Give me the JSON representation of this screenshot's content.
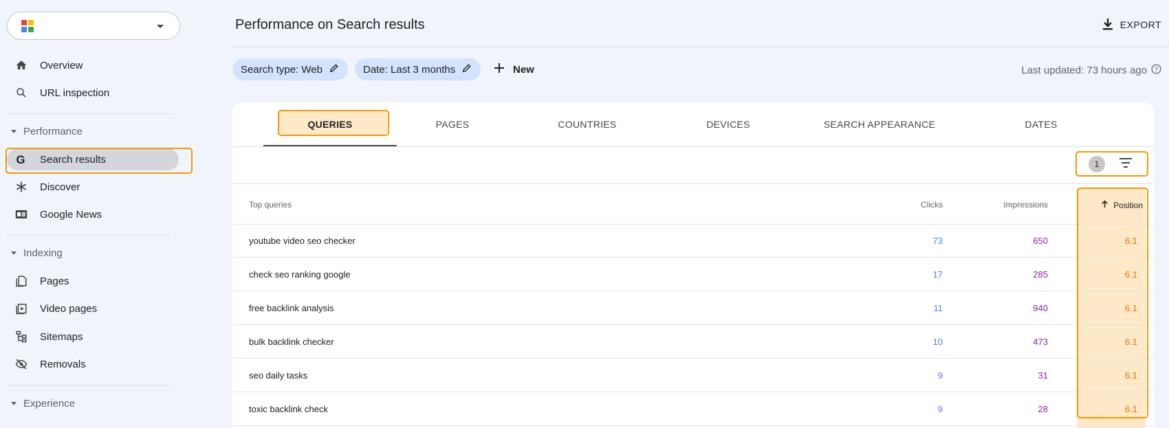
{
  "sidebar": {
    "logo_colors": [
      "#ea4335",
      "#fbbc04",
      "#4285f4",
      "#34a853"
    ],
    "items": {
      "overview": "Overview",
      "url_inspection": "URL inspection",
      "search_results": "Search results",
      "discover": "Discover",
      "google_news": "Google News",
      "pages": "Pages",
      "video_pages": "Video pages",
      "sitemaps": "Sitemaps",
      "removals": "Removals"
    },
    "sections": {
      "performance": "Performance",
      "indexing": "Indexing",
      "experience": "Experience"
    }
  },
  "header": {
    "title": "Performance on Search results",
    "export_label": "EXPORT"
  },
  "filters": {
    "search_type": "Search type: Web",
    "date": "Date: Last 3 months",
    "new_label": "New",
    "last_updated": "Last updated: 73 hours ago"
  },
  "tabs": {
    "queries": "QUERIES",
    "pages": "PAGES",
    "countries": "COUNTRIES",
    "devices": "DEVICES",
    "search_appearance": "SEARCH APPEARANCE",
    "dates": "DATES"
  },
  "filter_count": "1",
  "table": {
    "headers": {
      "query": "Top queries",
      "clicks": "Clicks",
      "impressions": "Impressions",
      "position": "Position"
    },
    "rows": [
      {
        "query": "youtube video seo checker",
        "clicks": "73",
        "impressions": "650",
        "position": "6.1"
      },
      {
        "query": "check seo ranking google",
        "clicks": "17",
        "impressions": "285",
        "position": "6.1"
      },
      {
        "query": "free backlink analysis",
        "clicks": "11",
        "impressions": "940",
        "position": "6.1"
      },
      {
        "query": "bulk backlink checker",
        "clicks": "10",
        "impressions": "473",
        "position": "6.1"
      },
      {
        "query": "seo daily tasks",
        "clicks": "9",
        "impressions": "31",
        "position": "6.1"
      },
      {
        "query": "toxic backlink check",
        "clicks": "9",
        "impressions": "28",
        "position": "6.1"
      }
    ]
  },
  "colors": {
    "highlight": "#f29900",
    "clicks": "#4285f4",
    "impressions": "#8e24aa",
    "position": "#e8710a"
  }
}
